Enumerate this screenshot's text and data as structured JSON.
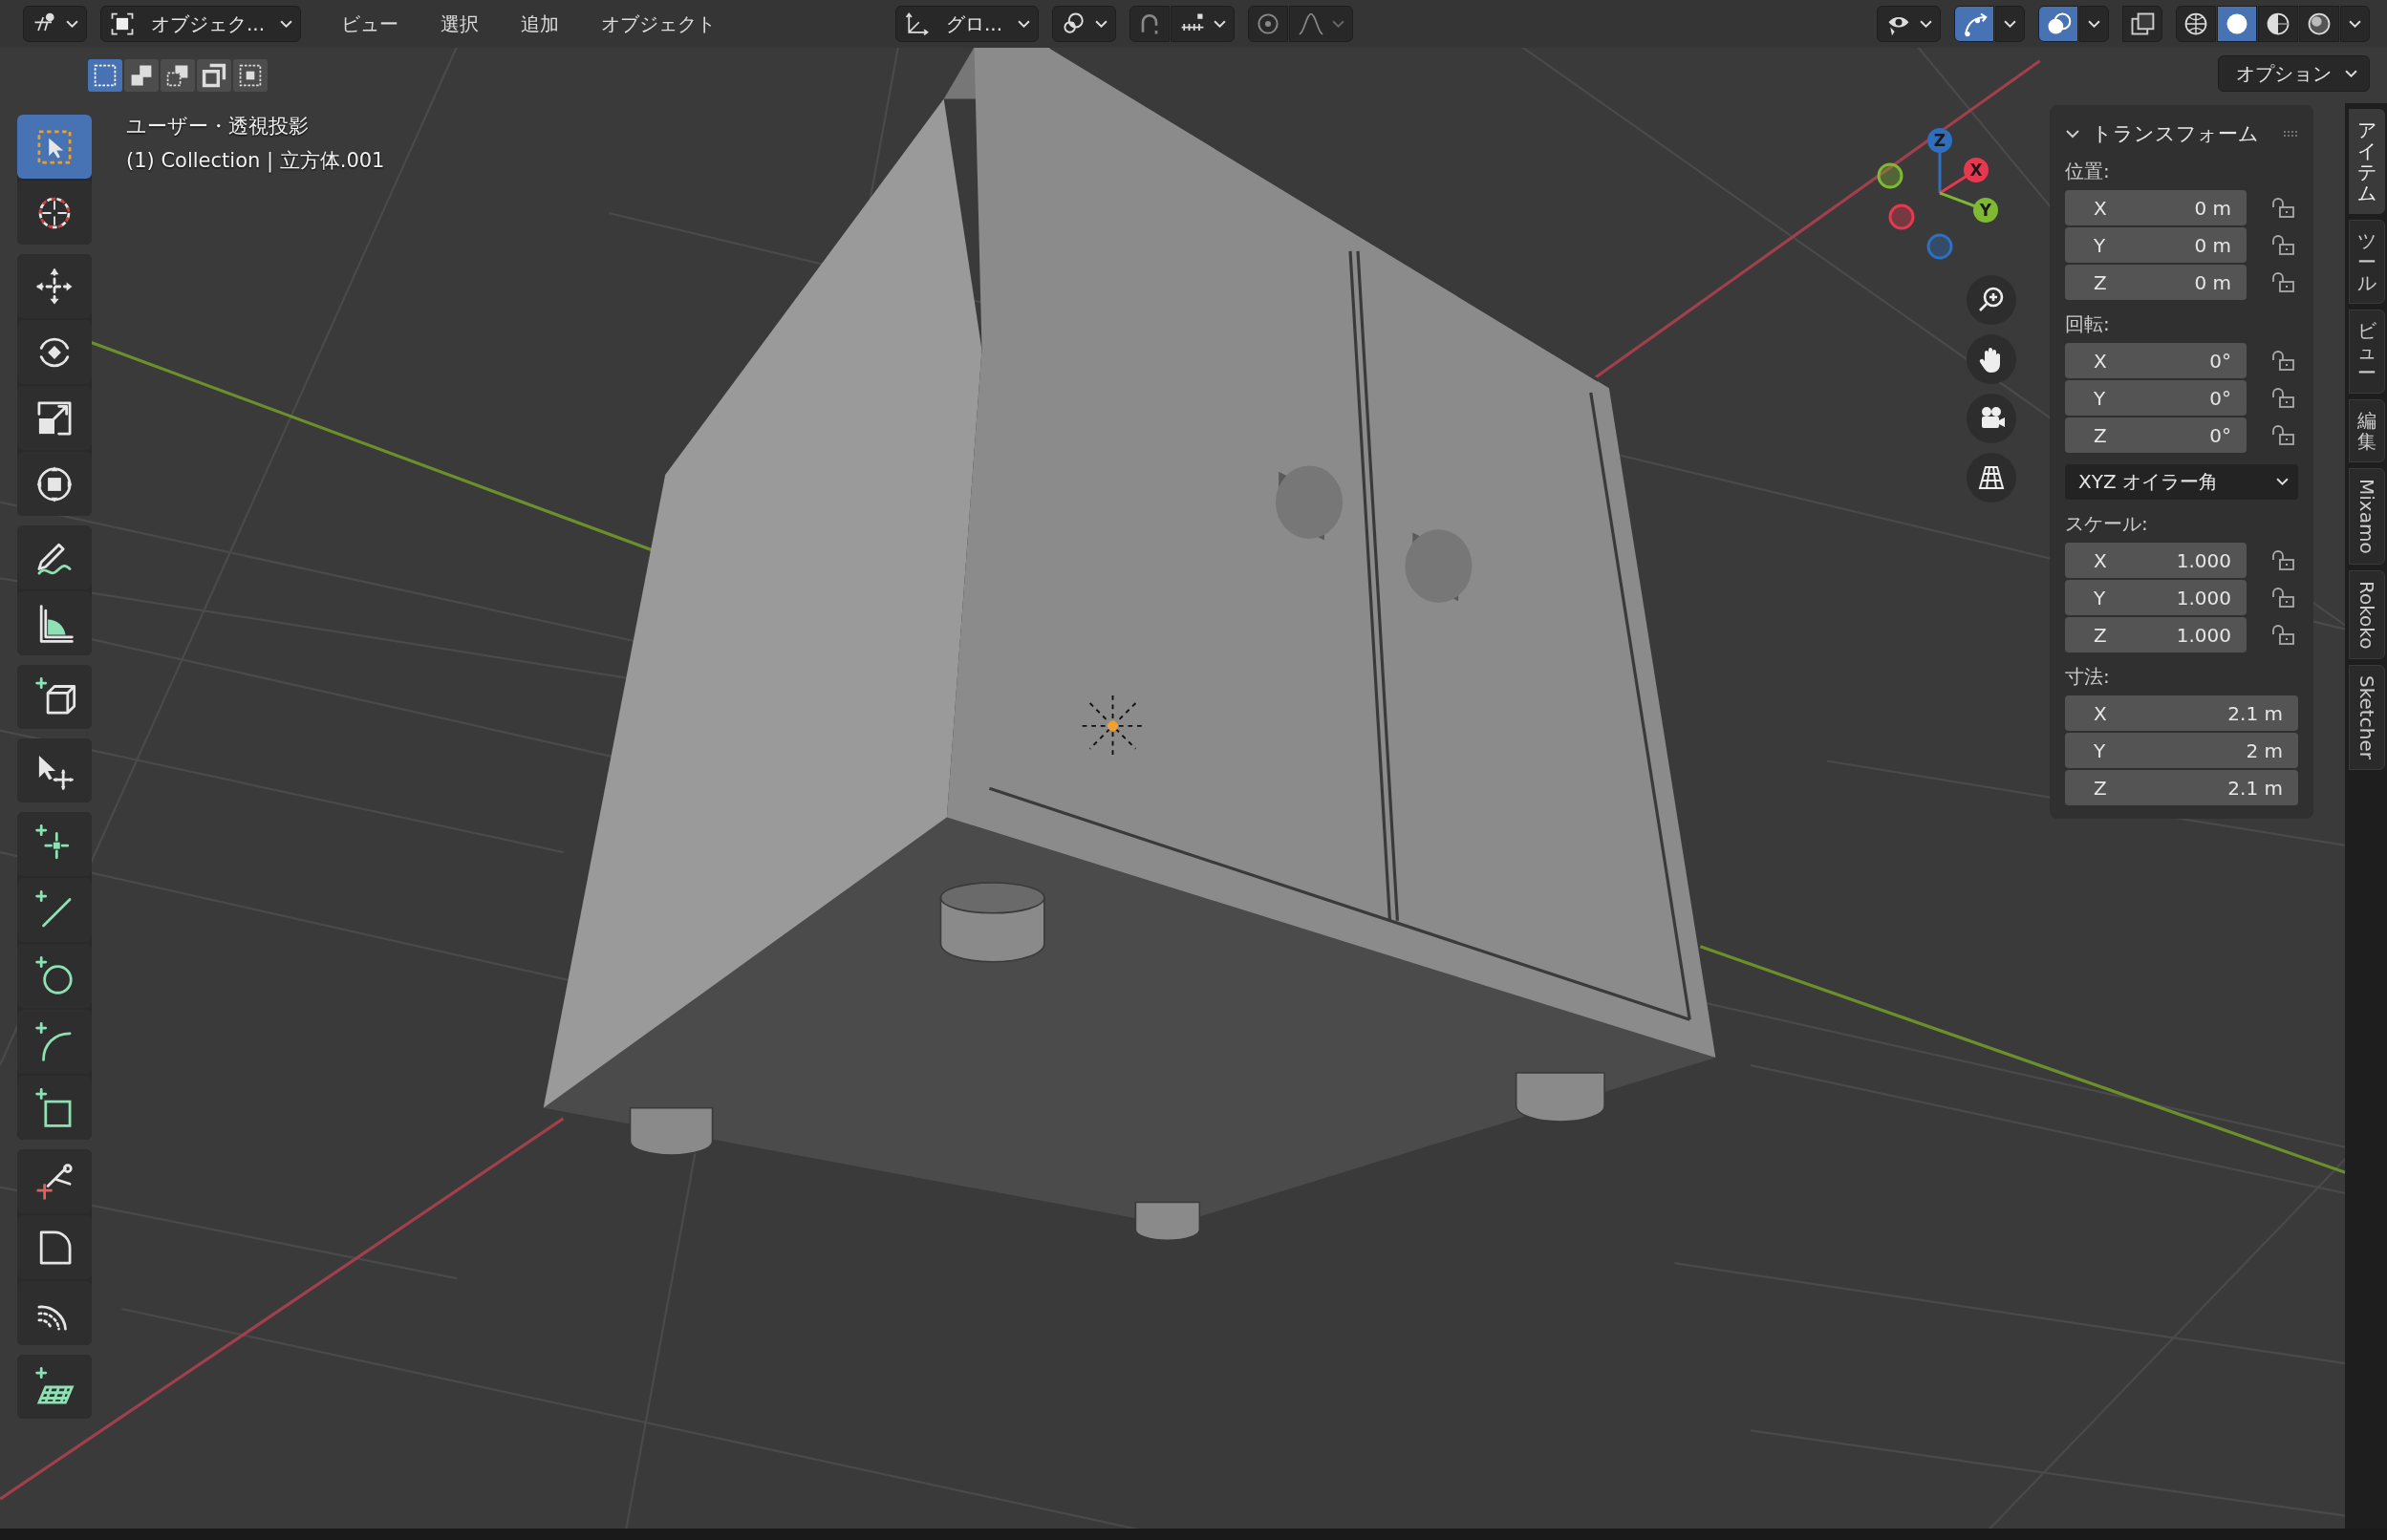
{
  "header": {
    "mode": "オブジェク...",
    "menus": [
      "ビュー",
      "選択",
      "追加",
      "オブジェクト"
    ],
    "orientation": "グロ...",
    "toggles": [
      {
        "kind": "gizmo",
        "on": true
      },
      {
        "kind": "overlay",
        "on": true
      },
      {
        "kind": "xray",
        "on": false
      }
    ],
    "shading": [
      {
        "kind": "wire",
        "selected": false
      },
      {
        "kind": "solid",
        "selected": true
      },
      {
        "kind": "material",
        "selected": false
      },
      {
        "kind": "rendered",
        "selected": false
      }
    ],
    "options": "オプション"
  },
  "select_modes": [
    {
      "kind": "new",
      "selected": true
    },
    {
      "kind": "extend",
      "selected": false
    },
    {
      "kind": "subtract",
      "selected": false
    },
    {
      "kind": "invert",
      "selected": false
    },
    {
      "kind": "intersect",
      "selected": false
    }
  ],
  "viewport": {
    "view_name": "ユーザー・透視投影",
    "object_info": "(1) Collection | 立方体.001"
  },
  "toolbar": [
    [
      {
        "kind": "select",
        "selected": true
      },
      {
        "kind": "cursor",
        "selected": false
      }
    ],
    [
      {
        "kind": "move",
        "selected": false
      },
      {
        "kind": "rotate",
        "selected": false
      },
      {
        "kind": "scale",
        "selected": false
      },
      {
        "kind": "transform",
        "selected": false
      }
    ],
    [
      {
        "kind": "annotate",
        "selected": false
      },
      {
        "kind": "measure",
        "selected": false
      }
    ],
    [
      {
        "kind": "add-cube",
        "selected": false
      }
    ],
    [
      {
        "kind": "cursor-move",
        "selected": false
      }
    ],
    [
      {
        "kind": "add-point",
        "selected": false
      },
      {
        "kind": "add-line",
        "selected": false
      },
      {
        "kind": "add-circle",
        "selected": false
      },
      {
        "kind": "add-arc",
        "selected": false
      },
      {
        "kind": "add-rect",
        "selected": false
      }
    ],
    [
      {
        "kind": "knife",
        "selected": false
      },
      {
        "kind": "corner",
        "selected": false
      },
      {
        "kind": "spin",
        "selected": false
      }
    ],
    [
      {
        "kind": "add-grid",
        "selected": false
      }
    ]
  ],
  "gizmo": {
    "axes": [
      {
        "label": "Z",
        "color": "#2f6fc0"
      },
      {
        "label": "X",
        "color": "#e8384f"
      },
      {
        "label": "Y",
        "color": "#7fb832"
      }
    ]
  },
  "transform_panel": {
    "title": "トランスフォーム",
    "expanded": true,
    "sections": [
      {
        "kind": "fields",
        "label": "位置:",
        "fields": [
          {
            "axis": "X",
            "value": "0 m",
            "locked": false
          },
          {
            "axis": "Y",
            "value": "0 m",
            "locked": false
          },
          {
            "axis": "Z",
            "value": "0 m",
            "locked": false
          }
        ]
      },
      {
        "kind": "fields",
        "label": "回転:",
        "fields": [
          {
            "axis": "X",
            "value": "0°",
            "locked": false
          },
          {
            "axis": "Y",
            "value": "0°",
            "locked": false
          },
          {
            "axis": "Z",
            "value": "0°",
            "locked": false
          }
        ]
      },
      {
        "kind": "dropdown",
        "value": "XYZ オイラー角"
      },
      {
        "kind": "fields",
        "label": "スケール:",
        "fields": [
          {
            "axis": "X",
            "value": "1.000",
            "locked": false
          },
          {
            "axis": "Y",
            "value": "1.000",
            "locked": false
          },
          {
            "axis": "Z",
            "value": "1.000",
            "locked": false
          }
        ]
      },
      {
        "kind": "fields",
        "label": "寸法:",
        "fields": [
          {
            "axis": "X",
            "value": "2.1 m"
          },
          {
            "axis": "Y",
            "value": "2 m"
          },
          {
            "axis": "Z",
            "value": "2.1 m"
          }
        ]
      }
    ]
  },
  "sidebar_tabs": [
    {
      "label": "アイテム",
      "kind": "cjk",
      "selected": true
    },
    {
      "label": "ツール",
      "kind": "cjk",
      "selected": false
    },
    {
      "label": "ビュー",
      "kind": "cjk",
      "selected": false
    },
    {
      "label": "編集",
      "kind": "cjk",
      "selected": false
    },
    {
      "label": "Mixamo",
      "kind": "latin",
      "selected": false
    },
    {
      "label": "Rokoko",
      "kind": "latin",
      "selected": false
    },
    {
      "label": "Sketcher",
      "kind": "latin",
      "selected": false
    }
  ]
}
